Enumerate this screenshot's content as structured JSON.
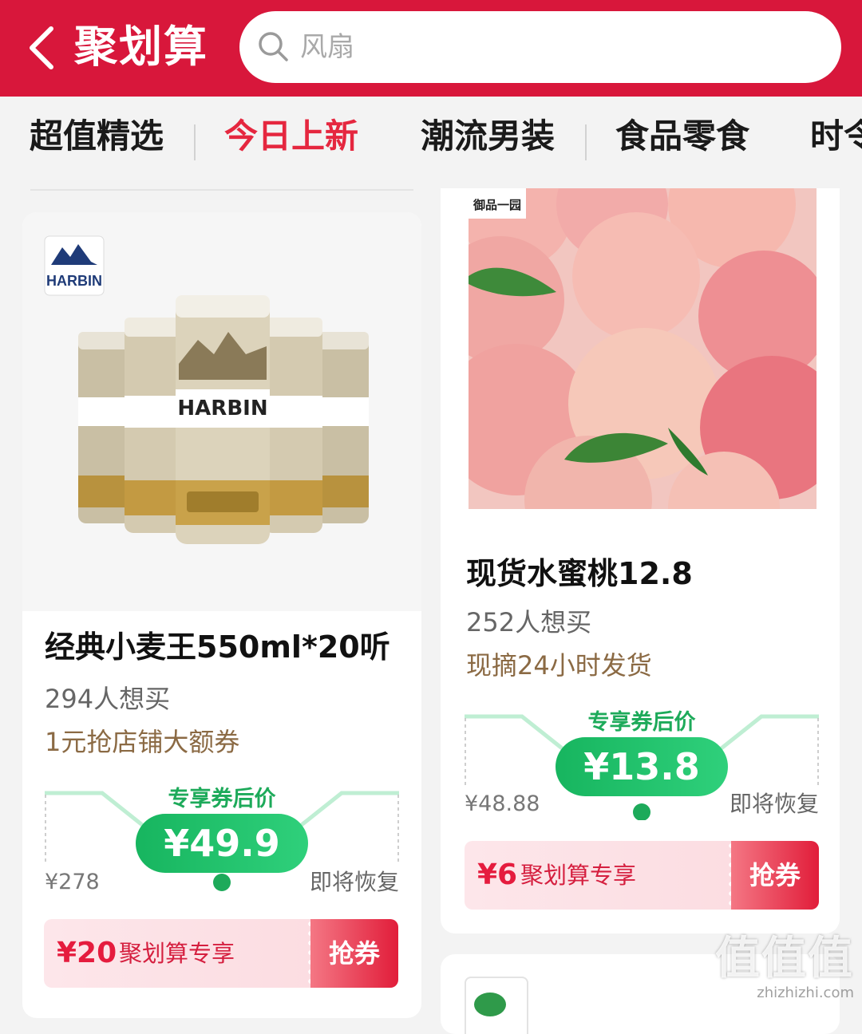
{
  "header": {
    "title": "聚划算",
    "search_placeholder": "风扇"
  },
  "tabs": [
    {
      "label": "超值精选",
      "active": false
    },
    {
      "label": "今日上新",
      "active": true
    },
    {
      "label": "潮流男装",
      "active": false
    },
    {
      "label": "食品零食",
      "active": false
    },
    {
      "label": "时令",
      "active": false
    }
  ],
  "products": [
    {
      "brand_logo_text": "哈尔滨啤酒 HARBIN",
      "image_desc_icon": "beer-cans-image",
      "name": "经典小麦王550ml*20听",
      "want_count": "294人想买",
      "promo": "1元抢店铺大额券",
      "price_label": "专享券后价",
      "price": "¥49.9",
      "original_price": "¥278",
      "restore_text": "即将恢复",
      "coupon_amount": "¥20",
      "coupon_label": "聚划算专享",
      "coupon_button": "抢券"
    },
    {
      "brand_logo_text": "御品一园",
      "image_desc_icon": "peaches-image",
      "name": "现货水蜜桃12.8",
      "want_count": "252人想买",
      "promo": "现摘24小时发货",
      "price_label": "专享券后价",
      "price": "¥13.8",
      "original_price": "¥48.88",
      "restore_text": "即将恢复",
      "coupon_amount": "¥6",
      "coupon_label": "聚划算专享",
      "coupon_button": "抢券"
    }
  ],
  "watermark": {
    "main": "值值值",
    "sub": "zhizhizhi.com"
  },
  "colors": {
    "header_bg": "#d8173b",
    "active_tab": "#e5273f",
    "price_green": "#1daa5a",
    "coupon_red": "#e51c3e",
    "promo_brown": "#8b6a44"
  }
}
